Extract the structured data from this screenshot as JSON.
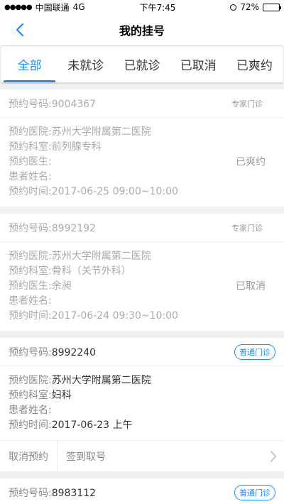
{
  "status_bar": {
    "carrier": "中国联通",
    "network": "4G",
    "time": "下午7:45",
    "battery": "72%",
    "battery_level": 0.72
  },
  "nav": {
    "title": "我的挂号"
  },
  "tabs": [
    {
      "label": "全部",
      "active": true
    },
    {
      "label": "未就诊",
      "active": false
    },
    {
      "label": "已就诊",
      "active": false
    },
    {
      "label": "已取消",
      "active": false
    },
    {
      "label": "已爽约",
      "active": false
    }
  ],
  "labels": {
    "number": "预约号码:",
    "hospital": "预约医院:",
    "department": "预约科室:",
    "doctor": "预约医生:",
    "patient": "患者姓名:",
    "time": "预约时间:"
  },
  "cards": [
    {
      "number": "9004367",
      "type": "专家门诊",
      "hospital": "苏州大学附属第二医院",
      "department": "前列腺专科",
      "doctor": "",
      "patient": "",
      "time": "2017-06-25 09:00~10:00",
      "status": "已爽约"
    },
    {
      "number": "8992192",
      "type": "专家门诊",
      "hospital": "苏州大学附属第二医院",
      "department": "骨科（关节外科）",
      "doctor": "余昶",
      "patient": "",
      "time": "2017-06-24 09:30~10:00",
      "status": "已取消"
    },
    {
      "number": "8992240",
      "type": "普通门诊",
      "hospital": "苏州大学附属第二医院",
      "department": "妇科",
      "patient": "",
      "time": "2017-06-23 上午",
      "actions": {
        "cancel": "取消预约",
        "checkin": "签到取号"
      }
    },
    {
      "number": "8983112",
      "type": "普通门诊"
    }
  ],
  "colors": {
    "accent": "#1a8cff",
    "background": "#efeff4"
  }
}
